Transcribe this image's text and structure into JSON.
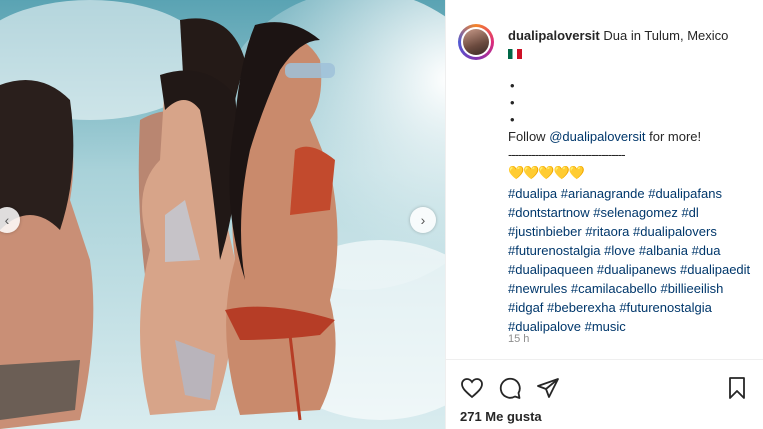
{
  "post": {
    "username": "dualipaloversit",
    "location_text": "Dua in Tulum, Mexico",
    "bullets": [
      "•",
      "•",
      "•"
    ],
    "follow_prefix": "Follow ",
    "follow_mention": "@dualipaloversit",
    "follow_suffix": " for more!",
    "separator": "-----------------------------------",
    "hearts": "💛💛💛💛💛",
    "hashtags": "#dualipa #arianagrande #dualipafans #dontstartnow #selenagomez #dl #justinbieber #ritaora #dualipalovers #futurenostalgia #love #albania #dua #dualipaqueen #dualipanews #dualipaedit #newrules #camilacabello #billieeilish #idgaf #beberexha #futurenostalgia #dualipalove #music",
    "time_ago": "15 h",
    "likes": "271 Me gusta"
  },
  "icons": {
    "like": "heart-icon",
    "comment": "comment-icon",
    "share": "send-icon",
    "save": "bookmark-icon",
    "prev": "chevron-left-icon",
    "next": "chevron-right-icon",
    "flag": "mexico-flag-icon"
  },
  "colors": {
    "text": "#262626",
    "link": "#00376b",
    "muted": "#8e8e8e"
  }
}
